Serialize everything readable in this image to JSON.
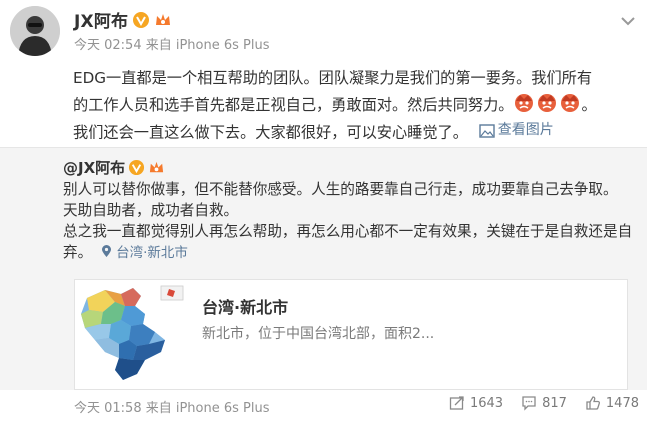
{
  "post": {
    "author": "JX阿布",
    "meta": "今天 02:54 来自 iPhone 6s Plus",
    "lines": [
      "EDG一直都是一个相互帮助的团队。团队凝聚力是我们的第一要务。我们所有",
      "的工作人员和选手首先都是正视自己，勇敢面对。然后共同努力。",
      "我们还会一直这么做下去。大家都很好，可以安心睡觉了。"
    ],
    "view_images": "查看图片"
  },
  "repost": {
    "author": "@JX阿布",
    "lines": [
      "别人可以替你做事，但不能替你感受。人生的路要靠自己行走，成功要靠自己去争取。",
      "天助自助者，成功者自救。",
      "总之我一直都觉得别人再怎么帮助，再怎么用心都不一定有效果，关键在于是自救还是自",
      "弃。"
    ],
    "location": "台湾·新北市",
    "location_card": {
      "title": "台湾·新北市",
      "desc": "新北市，位于中国台湾北部，面积2..."
    }
  },
  "footer": {
    "meta": "今天 01:58 来自 iPhone 6s Plus",
    "reposts": "1643",
    "comments": "817",
    "likes": "1478"
  },
  "colors": {
    "link": "#5b7a9a",
    "verified": "#f6a623",
    "meta": "#929292"
  }
}
